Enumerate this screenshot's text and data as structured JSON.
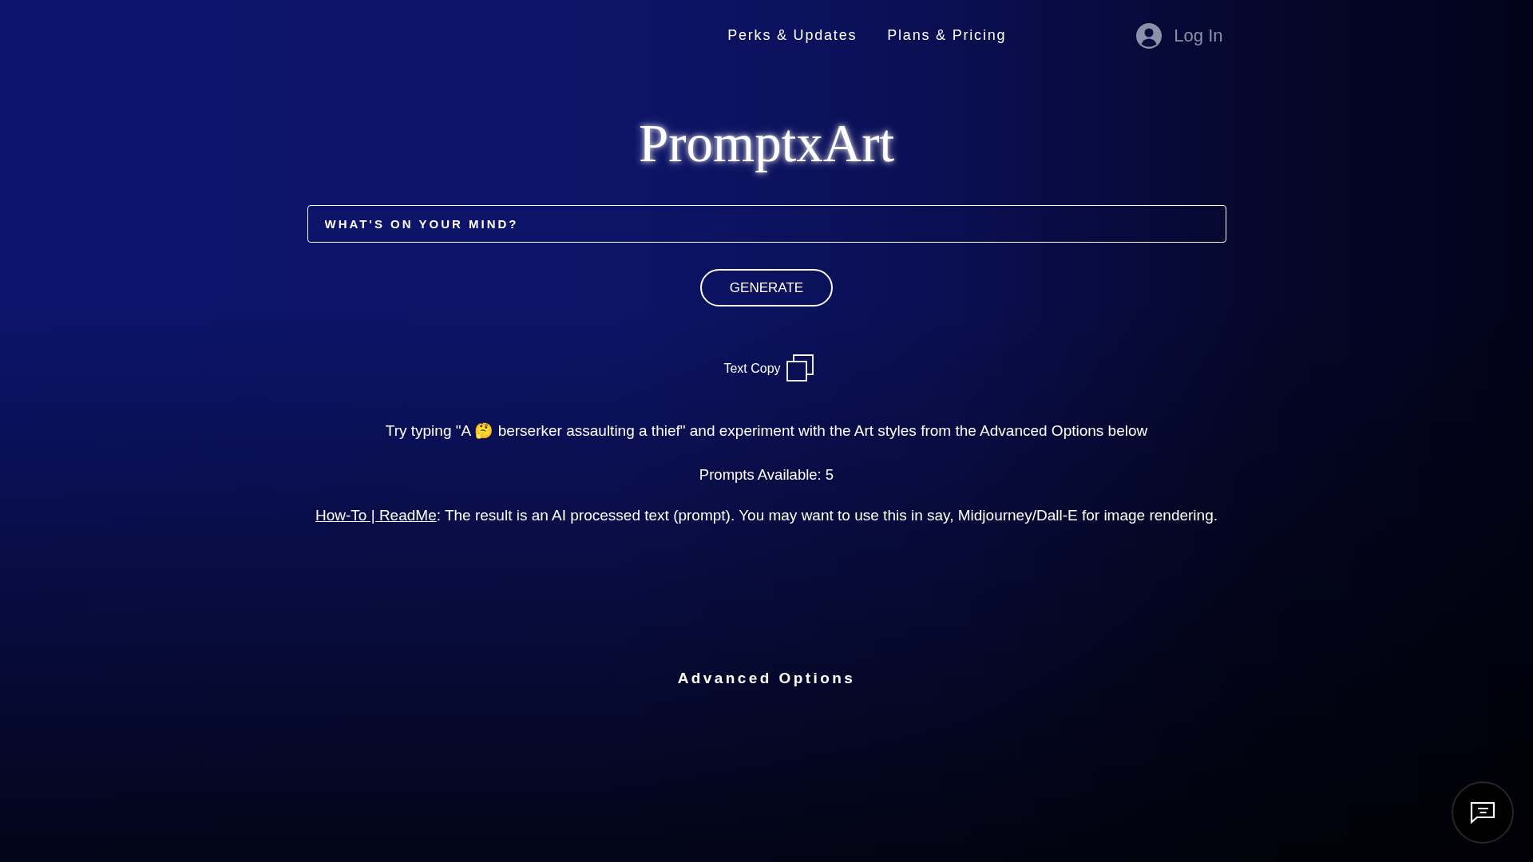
{
  "nav": {
    "links": [
      {
        "label": "Perks & Updates"
      },
      {
        "label": "Plans & Pricing"
      }
    ],
    "login": {
      "label": "Log In"
    }
  },
  "title": "PromptxArt",
  "prompt_field": {
    "placeholder": "WHAT'S ON YOUR MIND?"
  },
  "generate_button": "GENERATE",
  "text_copy": {
    "label": "Text Copy"
  },
  "hint": "Try typing \"A 🤔 berserker assaulting a thief\" and experiment with the Art styles from the Advanced Options below",
  "prompts_available": "Prompts Available: 5",
  "readme": {
    "link": "How-To | ReadMe",
    "text": ": The result is an AI processed text (prompt). You may want to use this in say, Midjourney/Dall-E for image rendering."
  },
  "advanced_options": "Advanced Options"
}
